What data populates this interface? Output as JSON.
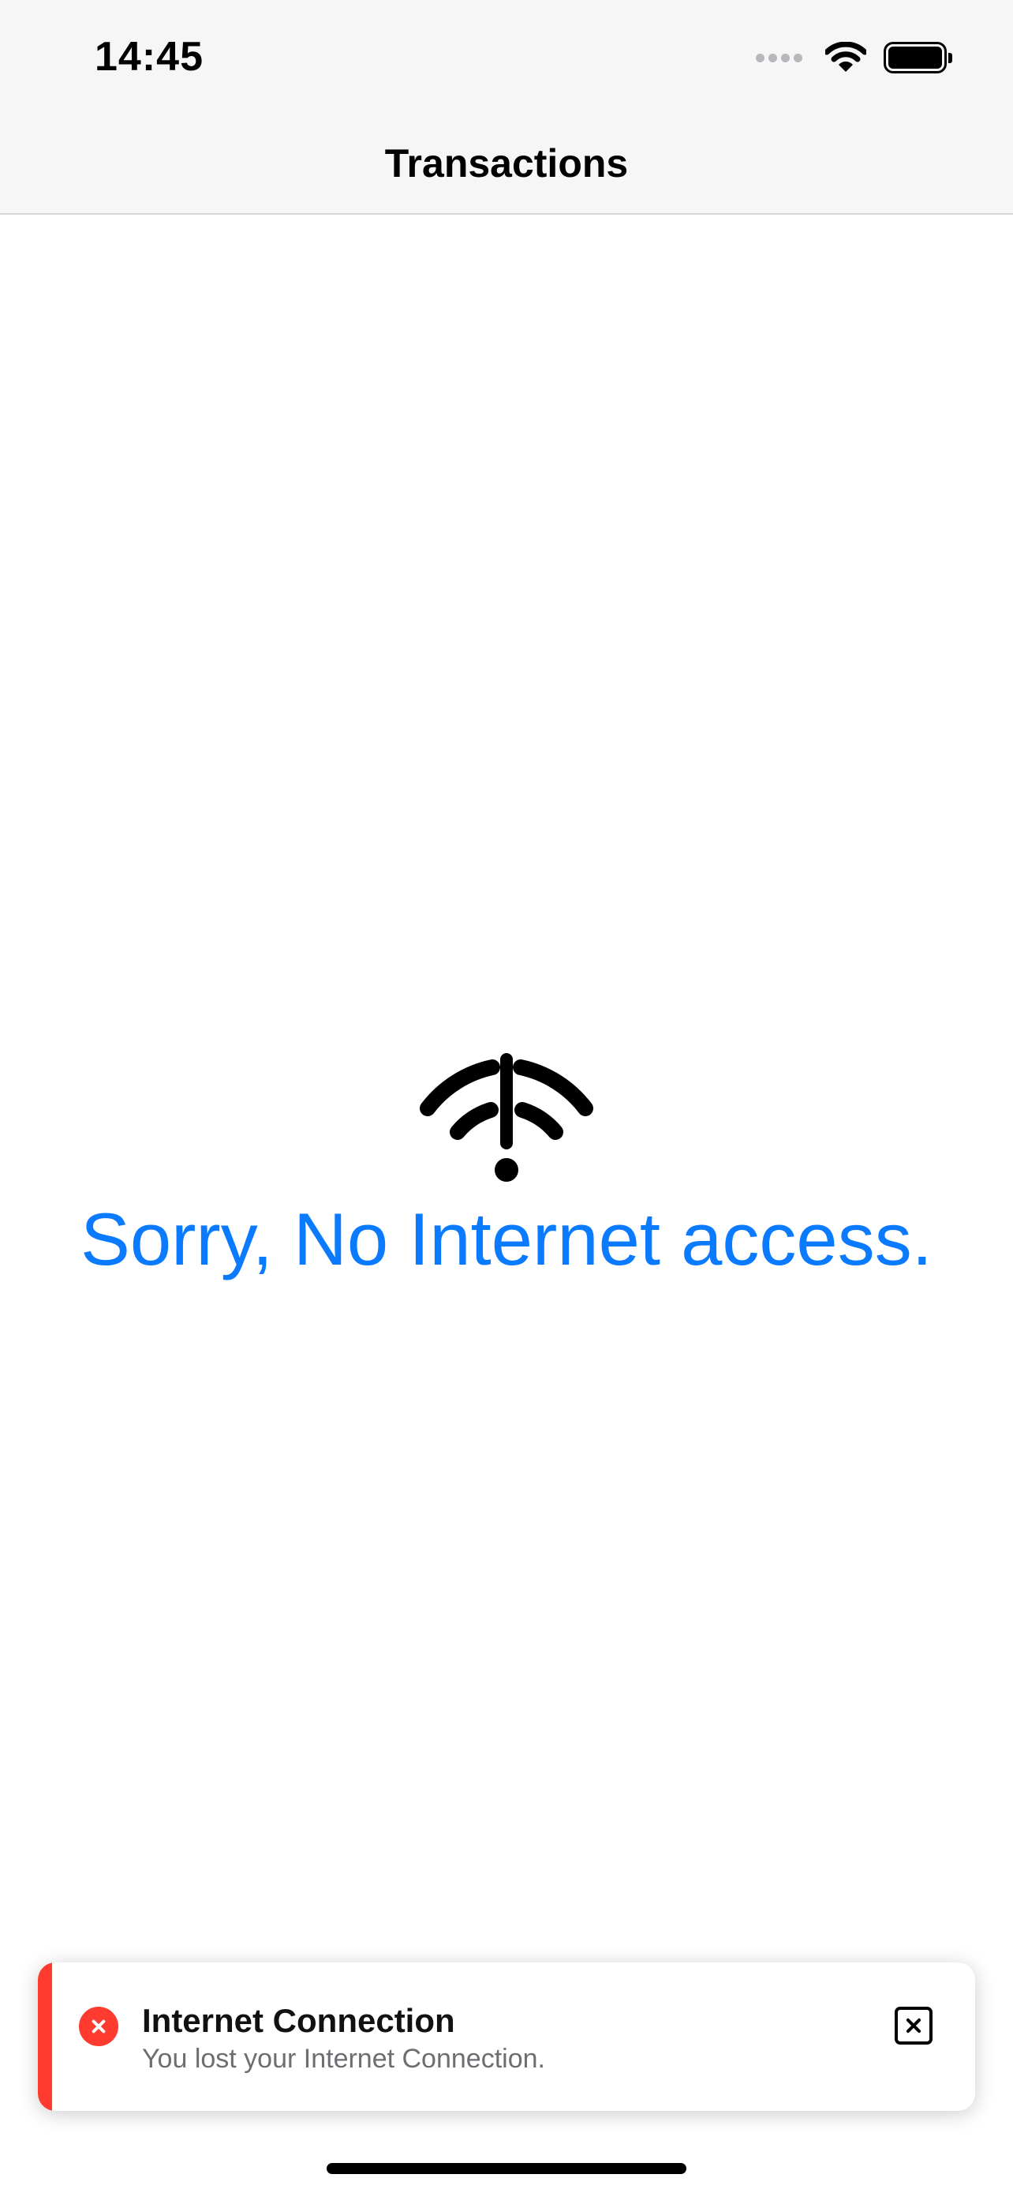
{
  "status_bar": {
    "time": "14:45",
    "icons": [
      "cellular-signal-icon",
      "wifi-icon",
      "battery-icon"
    ]
  },
  "header": {
    "title": "Transactions"
  },
  "empty_state": {
    "icon": "no-internet-wifi-icon",
    "message": "Sorry, No Internet access.",
    "message_color": "#0a7aff"
  },
  "toast": {
    "status_icon": "error-circle-icon",
    "title": "Internet Connection",
    "message": "You lost your Internet Connection.",
    "close_icon": "close-square-icon",
    "accent_color": "#ff3b30"
  }
}
